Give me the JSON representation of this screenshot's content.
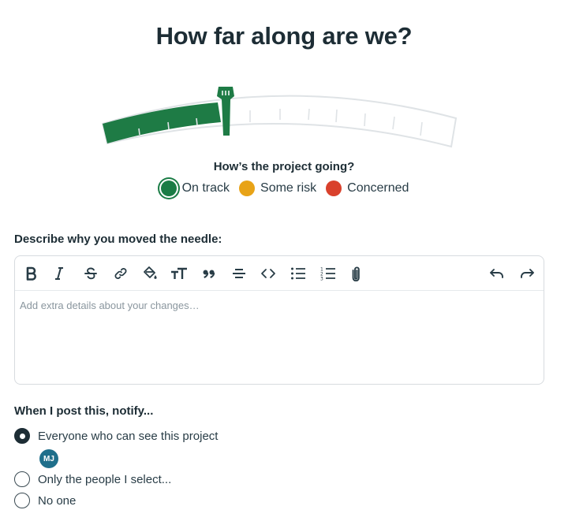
{
  "title": "How far along are we?",
  "gauge": {
    "progress": 0.3
  },
  "status": {
    "question": "How’s the project going?",
    "selected": "on_track",
    "options": [
      {
        "label": "On track",
        "color": "#1a7c45"
      },
      {
        "label": "Some risk",
        "color": "#e8a317"
      },
      {
        "label": "Concerned",
        "color": "#d9412c"
      }
    ]
  },
  "describe": {
    "label": "Describe why you moved the needle:",
    "placeholder": "Add extra details about your changes…",
    "toolbar": [
      "bold-icon",
      "italic-icon",
      "strikethrough-icon",
      "link-icon",
      "highlight-icon",
      "text-size-icon",
      "quote-icon",
      "horizontal-rule-icon",
      "code-icon",
      "bullet-list-icon",
      "numbered-list-icon",
      "attach-icon",
      "undo-icon",
      "redo-icon"
    ]
  },
  "notify": {
    "label": "When I post this, notify...",
    "options": [
      {
        "label": "Everyone who can see this project",
        "checked": true
      },
      {
        "label": "Only the people I select...",
        "checked": false
      },
      {
        "label": "No one",
        "checked": false
      }
    ],
    "avatar_initials": "MJ"
  }
}
